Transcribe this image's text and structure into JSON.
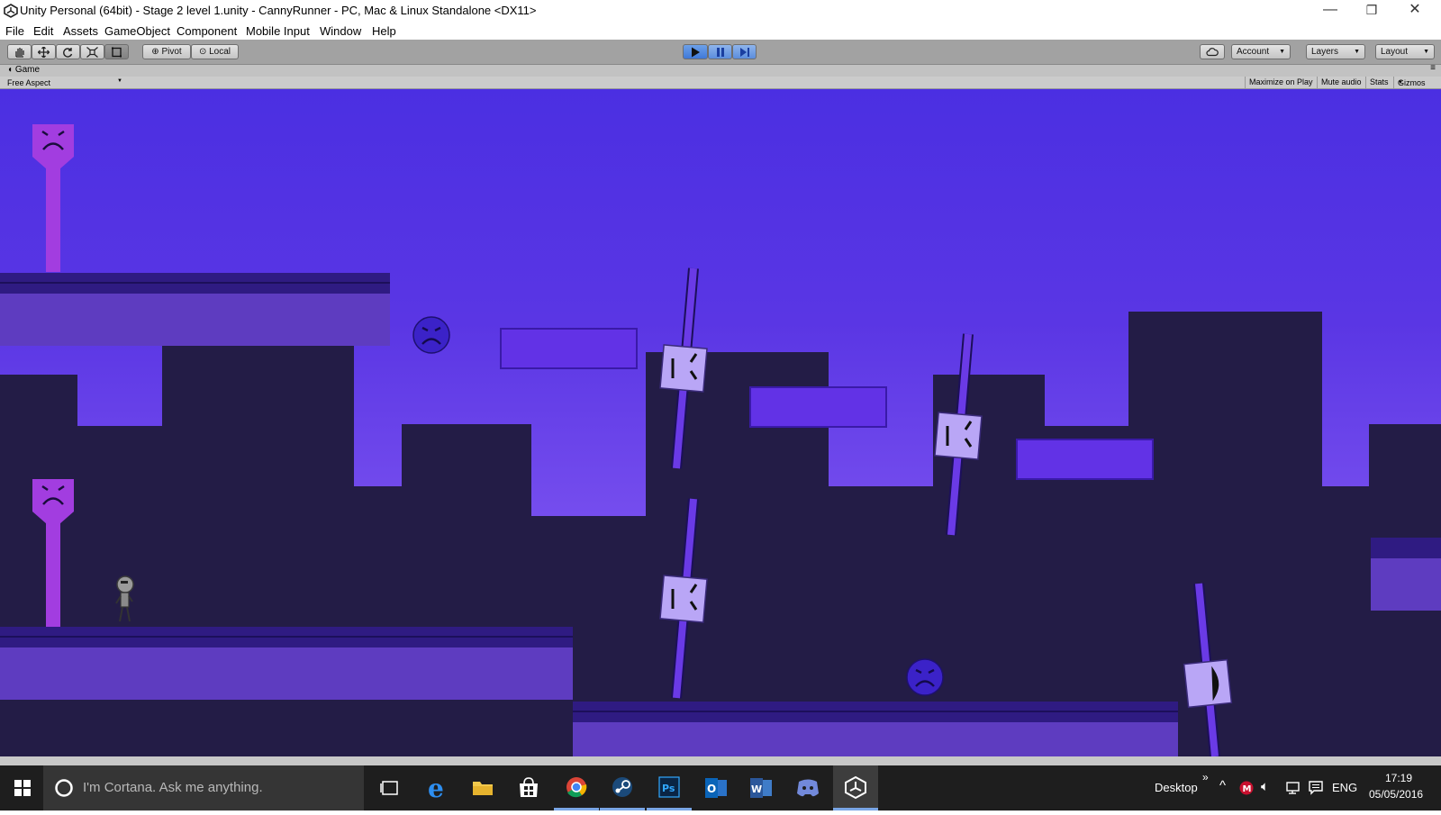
{
  "window": {
    "title": "Unity Personal (64bit) - Stage 2 level 1.unity - CannyRunner - PC, Mac & Linux Standalone <DX11>",
    "minimize": "—",
    "maximize": "❐",
    "close": "✕"
  },
  "menu": [
    "File",
    "Edit",
    "Assets",
    "GameObject",
    "Component",
    "Mobile Input",
    "Window",
    "Help"
  ],
  "toolbar": {
    "pivot": "Pivot",
    "local": "Local",
    "account": "Account",
    "layers": "Layers",
    "layout": "Layout"
  },
  "game_view": {
    "tab": "Game",
    "aspect": "Free Aspect",
    "maximize_on_play": "Maximize on Play",
    "mute_audio": "Mute audio",
    "stats": "Stats",
    "gizmos": "Gizmos"
  },
  "colors": {
    "sky": "#4b2fe2",
    "buildings": "#231c46",
    "platform": "#5e3cc0",
    "floating_block": "#6232e6",
    "enemy": "#3b22c8",
    "saw_block": "#b9a6f6",
    "pillar": "#a23de0"
  },
  "taskbar": {
    "search_placeholder": "I'm Cortana. Ask me anything.",
    "desktop": "Desktop",
    "language": "ENG",
    "time": "17:19",
    "date": "05/05/2016"
  }
}
